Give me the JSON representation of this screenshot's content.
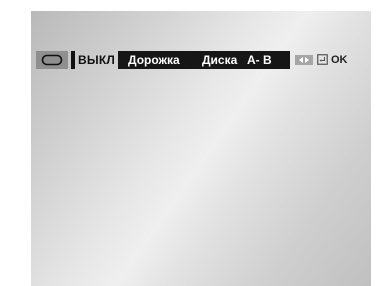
{
  "osd": {
    "repeat_icon": "repeat-icon",
    "repeat_status": "ВЫКЛ",
    "modes": [
      {
        "label": "Дорожка"
      },
      {
        "label": "Диска"
      },
      {
        "label": "A- B"
      }
    ],
    "nav_hint_icon": "left-right-arrows-icon",
    "enter_icon": "enter-icon",
    "ok_label": "OK"
  },
  "colors": {
    "strip_background": "#161616",
    "strip_text": "#ffffff",
    "repeat_button": "#8f8f8f",
    "screen_gradient_light": "#efefef",
    "screen_gradient_dark": "#b9b9b9"
  }
}
